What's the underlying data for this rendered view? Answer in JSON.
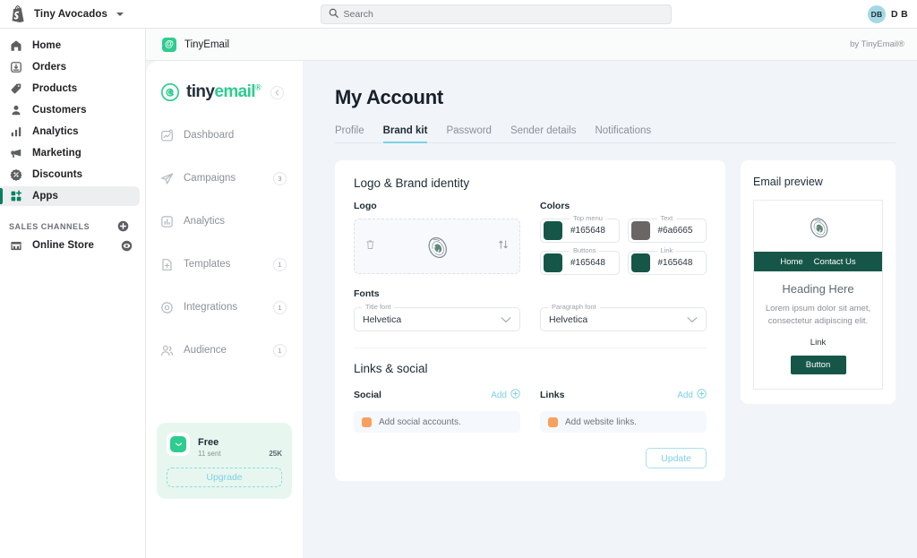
{
  "topbar": {
    "store_name": "Tiny Avocados",
    "search_placeholder": "Search",
    "avatar_initials": "DB",
    "user_name": "D B"
  },
  "shopify_nav": {
    "items": [
      {
        "label": "Home",
        "icon": "home-icon",
        "active": false
      },
      {
        "label": "Orders",
        "icon": "orders-icon",
        "active": false
      },
      {
        "label": "Products",
        "icon": "products-tag-icon",
        "active": false
      },
      {
        "label": "Customers",
        "icon": "customers-icon",
        "active": false
      },
      {
        "label": "Analytics",
        "icon": "analytics-bars-icon",
        "active": false
      },
      {
        "label": "Marketing",
        "icon": "marketing-megaphone-icon",
        "active": false
      },
      {
        "label": "Discounts",
        "icon": "discounts-badge-icon",
        "active": false
      },
      {
        "label": "Apps",
        "icon": "apps-grid-icon",
        "active": true
      }
    ],
    "section_label": "SALES CHANNELS",
    "channels": [
      {
        "label": "Online Store",
        "icon": "storefront-icon",
        "trailing_icon": "eye-icon"
      }
    ]
  },
  "app_header": {
    "app_name": "TinyEmail",
    "badge_glyph": "@",
    "attribution": "by TinyEmail®"
  },
  "tinyemail_sidebar": {
    "wordmark_part1": "tiny",
    "wordmark_part2": "email",
    "wordmark_registered": "®",
    "collapse_icon": "chevron-left-icon",
    "nav": [
      {
        "label": "Dashboard",
        "icon": "dashboard-icon",
        "badge": ""
      },
      {
        "label": "Campaigns",
        "icon": "campaigns-send-icon",
        "badge": "3"
      },
      {
        "label": "Analytics",
        "icon": "analytics-chart-icon",
        "badge": ""
      },
      {
        "label": "Templates",
        "icon": "templates-file-icon",
        "badge": "1"
      },
      {
        "label": "Integrations",
        "icon": "integrations-gear-icon",
        "badge": "1"
      },
      {
        "label": "Audience",
        "icon": "audience-people-icon",
        "badge": "1"
      }
    ],
    "plan": {
      "name": "Free",
      "sent_label": "11 sent",
      "cap_label": "25K",
      "progress_percent": 4,
      "upgrade_label": "Upgrade",
      "icon": "envelope-icon"
    }
  },
  "page": {
    "title": "My Account",
    "tabs": [
      {
        "label": "Profile",
        "active": false
      },
      {
        "label": "Brand kit",
        "active": true
      },
      {
        "label": "Password",
        "active": false
      },
      {
        "label": "Sender details",
        "active": false
      },
      {
        "label": "Notifications",
        "active": false
      }
    ]
  },
  "brand_kit": {
    "section_title": "Logo & Brand identity",
    "logo_label": "Logo",
    "logo_delete_icon": "trash-icon",
    "logo_swap_icon": "swap-arrows-icon",
    "logo_image": "avocado-logo",
    "colors_label": "Colors",
    "colors": [
      {
        "caption": "Top menu",
        "value": "#165648",
        "hex": "#165648"
      },
      {
        "caption": "Text",
        "value": "#6a6665",
        "hex": "#6a6665"
      },
      {
        "caption": "Buttons",
        "value": "#165648",
        "hex": "#165648"
      },
      {
        "caption": "Link",
        "value": "#165648",
        "hex": "#165648"
      }
    ],
    "fonts_label": "Fonts",
    "fonts": [
      {
        "caption": "Title font",
        "value": "Helvetica"
      },
      {
        "caption": "Paragraph font",
        "value": "Helvetica"
      }
    ],
    "links_section_title": "Links & social",
    "social": {
      "label": "Social",
      "add_label": "Add",
      "add_icon": "plus-circle-icon",
      "empty_row": "Add social accounts."
    },
    "links": {
      "label": "Links",
      "add_label": "Add",
      "add_icon": "plus-circle-icon",
      "empty_row": "Add website links."
    },
    "update_label": "Update"
  },
  "email_preview": {
    "title": "Email preview",
    "logo_image": "avocado-logo",
    "menu": [
      "Home",
      "Contact Us"
    ],
    "menu_bg": "#165648",
    "heading": "Heading Here",
    "paragraph": "Lorem ipsum dolor sit amet, consectetur adipiscing elit.",
    "link_label": "Link",
    "button_label": "Button",
    "button_bg": "#165648"
  }
}
